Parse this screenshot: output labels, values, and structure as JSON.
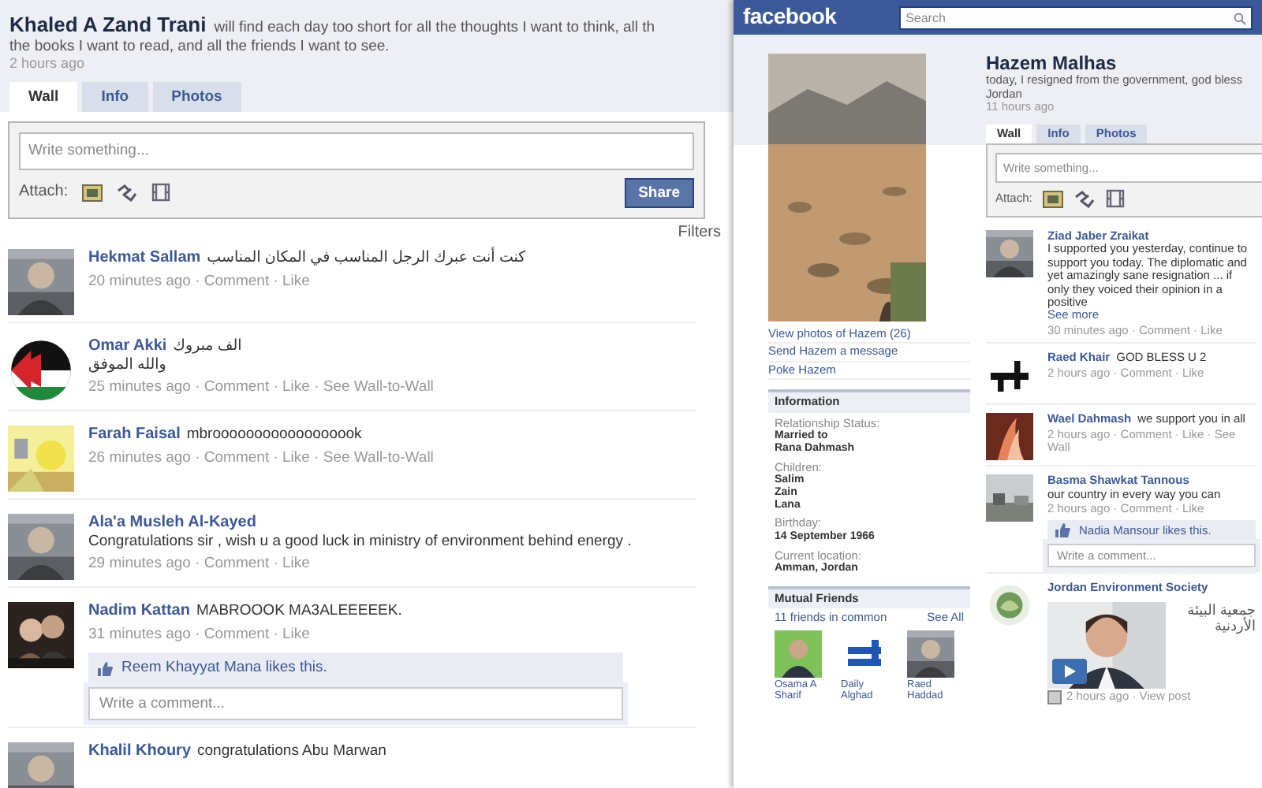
{
  "profile": {
    "name": "Khaled A Zand Trani",
    "status_lines": [
      "will find each day too short for all the thoughts I want to think, all th",
      "the books I want to read, and all the friends I want to see."
    ],
    "status_time": "2 hours ago",
    "tabs": [
      {
        "label": "Wall",
        "selected": true
      },
      {
        "label": "Info",
        "selected": false
      },
      {
        "label": "Photos",
        "selected": false
      }
    ],
    "composer": {
      "placeholder": "Write something...",
      "attach_label": "Attach:",
      "button": "Share"
    },
    "filters_link": "Filters",
    "posts": [
      {
        "author": "Hekmat Sallam",
        "text": "كنت أنت عبرك الرجل المناسب في المكان المناسب",
        "meta": "20 minutes ago · Comment · Like"
      },
      {
        "author": "Omar Akki",
        "text": "الف مبروك",
        "more": "والله الموفق",
        "meta": "25 minutes ago · Comment · Like · See Wall-to-Wall"
      },
      {
        "author": "Farah Faisal",
        "text": "mbroooooooooooooooook",
        "meta": "26 minutes ago · Comment · Like · See Wall-to-Wall"
      },
      {
        "author": "Ala'a Musleh Al-Kayed",
        "text": "Congratulations sir , wish u a good luck in ministry of environment behind energy .",
        "meta": "29 minutes ago · Comment · Like"
      },
      {
        "author": "Nadim Kattan",
        "text": "MABROOOK MA3ALEEEEEK.",
        "meta": "31 minutes ago · Comment · Like",
        "likes": "Reem Khayyat Mana likes this.",
        "comment_placeholder": "Write a comment..."
      },
      {
        "author": "Khalil Khoury",
        "text": "congratulations Abu Marwan"
      }
    ]
  },
  "second_window": {
    "logo": "facebook",
    "search": {
      "placeholder": "Search"
    },
    "sidebar": {
      "links": [
        "View photos of Hazem (26)",
        "Send Hazem a message",
        "Poke Hazem"
      ],
      "information": {
        "title": "Information",
        "fields": [
          {
            "label": "Relationship Status:",
            "values": [
              "Married to",
              "Rana Dahmash"
            ]
          },
          {
            "label": "Children:",
            "values": [
              "Salim",
              "Zain",
              "Lana"
            ]
          },
          {
            "label": "Birthday:",
            "values": [
              "14 September 1966"
            ]
          },
          {
            "label": "Current location:",
            "values": [
              "Amman, Jordan"
            ]
          }
        ]
      },
      "mutual_friends": {
        "title": "Mutual Friends",
        "count": "11 friends in common",
        "see_all": "See All",
        "friends": [
          "Osama A Sharif",
          "Daily Alghad",
          "Raed Haddad"
        ]
      }
    },
    "profile": {
      "name": "Hazem Malhas",
      "status": "today, I resigned from the government, god bless Jordan",
      "time": "11 hours ago",
      "tabs": [
        {
          "label": "Wall",
          "selected": true
        },
        {
          "label": "Info",
          "selected": false
        },
        {
          "label": "Photos",
          "selected": false
        }
      ],
      "composer": {
        "placeholder": "Write something...",
        "attach_label": "Attach:"
      }
    },
    "posts": [
      {
        "author": "Ziad Jaber Zraikat",
        "text": "I supported you yesterday, continue to support you today. The diplomatic and yet amazingly sane resignation ... if only they voiced their opinion in a positive",
        "see_more": "See more",
        "meta": "30 minutes ago · Comment · Like"
      },
      {
        "author": "Raed Khair",
        "text": "GOD BLESS U 2",
        "meta": "2 hours ago · Comment · Like"
      },
      {
        "author": "Wael Dahmash",
        "text": "we support you in all",
        "meta": "2 hours ago · Comment · Like · See Wall"
      },
      {
        "author": "Basma Shawkat Tannous",
        "text": "our country in every way you can",
        "meta": "2 hours ago · Comment · Like",
        "likes": "Nadia Mansour likes this.",
        "comment_placeholder": "Write a comment..."
      },
      {
        "author": "Jordan Environment Society",
        "video_caption": "جمعية البيئة الأردنية",
        "meta": "2 hours ago · View post"
      }
    ]
  }
}
